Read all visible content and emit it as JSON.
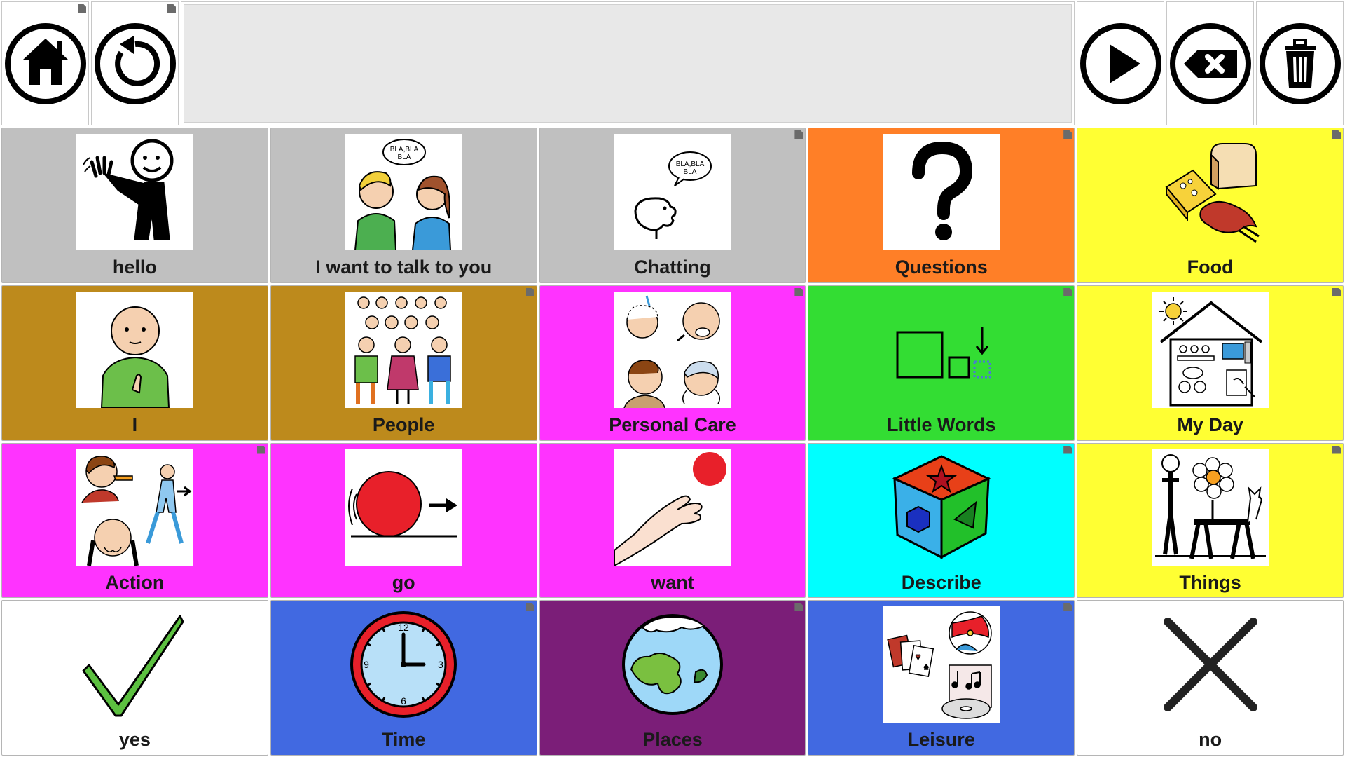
{
  "toolbar": {
    "left": [
      {
        "icon": "home-icon"
      },
      {
        "icon": "undo-icon"
      }
    ],
    "message_bar": {
      "text": ""
    },
    "right": [
      {
        "icon": "speak-play-icon"
      },
      {
        "icon": "backspace-icon"
      },
      {
        "icon": "trash-icon"
      }
    ]
  },
  "grid": {
    "rows": [
      [
        {
          "label": "hello",
          "color": "#c0c0c0",
          "icon": "waving-person-icon"
        },
        {
          "label": "I want to talk to you",
          "color": "#c0c0c0",
          "icon": "two-people-talking-icon"
        },
        {
          "label": "Chatting",
          "color": "#c0c0c0",
          "icon": "speech-bubble-head-icon"
        },
        {
          "label": "Questions",
          "color": "#ff7f27",
          "icon": "question-mark-icon"
        },
        {
          "label": "Food",
          "color": "#ffff33",
          "icon": "food-icon"
        }
      ],
      [
        {
          "label": "I",
          "color": "#bd8a1c",
          "icon": "self-pointing-person-icon"
        },
        {
          "label": "People",
          "color": "#bd8a1c",
          "icon": "group-of-people-icon"
        },
        {
          "label": "Personal Care",
          "color": "#ff33ff",
          "icon": "personal-care-icon"
        },
        {
          "label": "Little Words",
          "color": "#33dd33",
          "icon": "little-words-icon"
        },
        {
          "label": "My Day",
          "color": "#ffff33",
          "icon": "house-day-icon"
        }
      ],
      [
        {
          "label": "Action",
          "color": "#ff33ff",
          "icon": "action-people-icon"
        },
        {
          "label": "go",
          "color": "#ff33ff",
          "icon": "rolling-ball-icon"
        },
        {
          "label": "want",
          "color": "#ff33ff",
          "icon": "reaching-hand-icon"
        },
        {
          "label": "Describe",
          "color": "#00ffff",
          "icon": "shape-cube-icon"
        },
        {
          "label": "Things",
          "color": "#ffff33",
          "icon": "things-icon"
        }
      ],
      [
        {
          "label": "yes",
          "color": "#ffffff",
          "icon": "checkmark-icon"
        },
        {
          "label": "Time",
          "color": "#4169e1",
          "icon": "clock-icon"
        },
        {
          "label": "Places",
          "color": "#7b1e78",
          "icon": "globe-icon"
        },
        {
          "label": "Leisure",
          "color": "#4169e1",
          "icon": "leisure-icon"
        },
        {
          "label": "no",
          "color": "#ffffff",
          "icon": "cross-icon"
        }
      ]
    ]
  }
}
